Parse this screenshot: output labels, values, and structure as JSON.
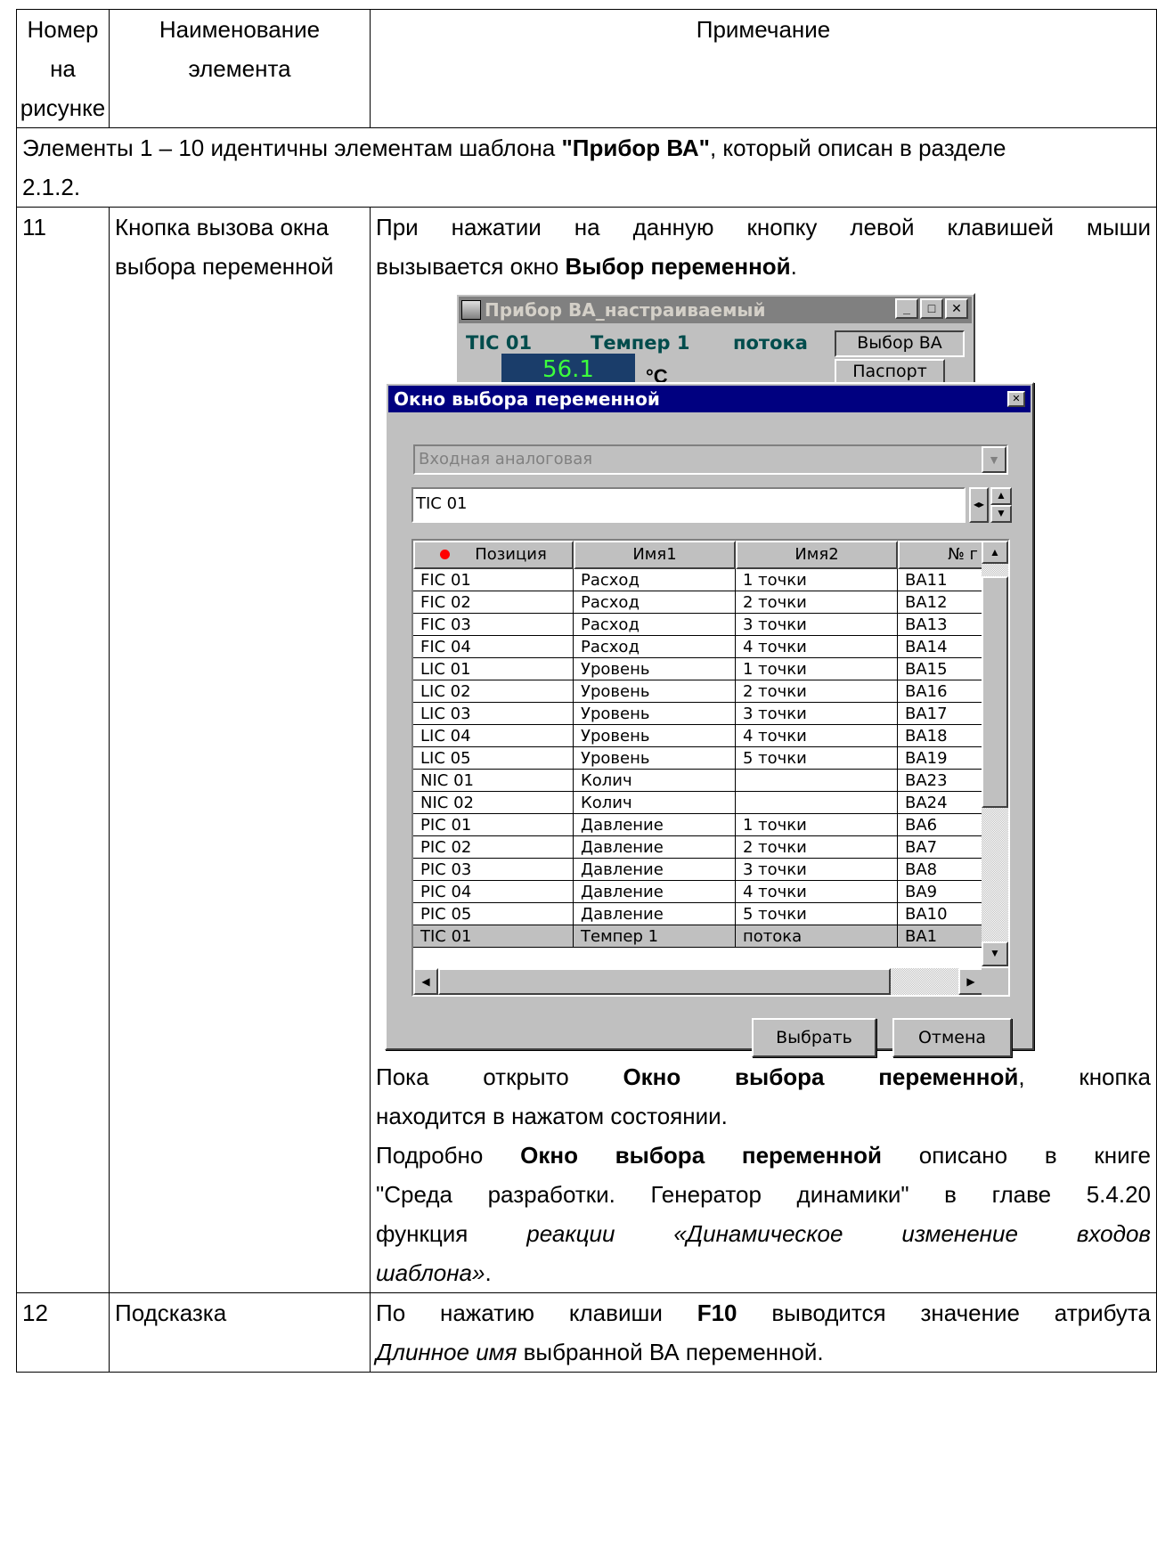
{
  "header": {
    "col1": [
      "Номер",
      "на",
      "рисунке"
    ],
    "col2": [
      "Наименование",
      "элемента"
    ],
    "col3": "Примечание"
  },
  "span_row": {
    "prefix": "Элементы 1 – 10 идентичны элементам  шаблона ",
    "bold": "\"Прибор ВА\"",
    "suffix": ", который описан в разделе",
    "line2": "2.1.2."
  },
  "row11": {
    "num": "11",
    "name_lines": [
      "Кнопка вызова окна",
      "выбора переменной"
    ],
    "p1_line1": "При нажатии на данную кнопку левой клавишей мыши",
    "p1_line2_pre": "вызывается окно ",
    "p1_line2_bold": "Выбор переменной",
    "p1_line2_post": ".",
    "p2_line1_a": "Пока",
    "p2_line1_b": "открыто",
    "p2_line1_bold1": "Окно",
    "p2_line1_bold2": "выбора",
    "p2_line1_bold3": "переменной",
    "p2_line1_c": ",",
    "p2_line1_d": "кнопка",
    "p2_line2": "находится в нажатом состоянии.",
    "p3_line1_pre": "Подробно ",
    "p3_line1_bold": "Окно выбора переменной",
    "p3_line1_post": " описано в книге",
    "p3_line2": "\"Среда разработки. Генератор динамики\" в главе 5.4.20",
    "p3_line3_pre": "функция ",
    "p3_line3_italic": "реакции «Динамическое изменение входов",
    "p3_line4_italic": "шаблона»",
    "p3_line4_post": "."
  },
  "row12": {
    "num": "12",
    "name": "Подсказка",
    "line1_pre": "По нажатию клавиши ",
    "line1_bold": "F10",
    "line1_post": "  выводится значение атрибута",
    "line2_italic": "Длинное имя",
    "line2_post": " выбранной ВА переменной."
  },
  "device_window": {
    "title": "Прибор ВА_настраиваемый",
    "position": "TIC 01",
    "name1": "Темпер 1",
    "name2": "потока",
    "value": "56.1",
    "unit": "°C",
    "btn_select": "Выбор ВА",
    "btn_passport": "Паспорт"
  },
  "select_window": {
    "title": "Окно выбора переменной",
    "combo_value": "Входная аналоговая",
    "edit_value": "TIC 01",
    "columns": [
      "Позиция",
      "Имя1",
      "Имя2",
      "№ г"
    ],
    "rows": [
      [
        "FIC 01",
        "Расход",
        "1 точки",
        "ВА11"
      ],
      [
        "FIC 02",
        "Расход",
        "2 точки",
        "ВА12"
      ],
      [
        "FIC 03",
        "Расход",
        "3 точки",
        "ВА13"
      ],
      [
        "FIC 04",
        "Расход",
        "4 точки",
        "ВА14"
      ],
      [
        "LIC 01",
        "Уровень",
        "1 точки",
        "ВА15"
      ],
      [
        "LIC 02",
        "Уровень",
        "2 точки",
        "ВА16"
      ],
      [
        "LIC 03",
        "Уровень",
        "3 точки",
        "ВА17"
      ],
      [
        "LIC 04",
        "Уровень",
        "4 точки",
        "ВА18"
      ],
      [
        "LIC 05",
        "Уровень",
        "5 точки",
        "ВА19"
      ],
      [
        "NIC 01",
        "Колич",
        "",
        "ВА23"
      ],
      [
        "NIC 02",
        "Колич",
        "",
        "ВА24"
      ],
      [
        "PIC 01",
        "Давление",
        "1 точки",
        "ВА6"
      ],
      [
        "PIC 02",
        "Давление",
        "2 точки",
        "ВА7"
      ],
      [
        "PIC 03",
        "Давление",
        "3 точки",
        "ВА8"
      ],
      [
        "PIC 04",
        "Давление",
        "4 точки",
        "ВА9"
      ],
      [
        "PIC 05",
        "Давление",
        "5 точки",
        "ВА10"
      ],
      [
        "TIC 01",
        "Темпер 1",
        "потока",
        "ВА1"
      ]
    ],
    "selected_row": 16,
    "btn_ok": "Выбрать",
    "btn_cancel": "Отмена"
  }
}
